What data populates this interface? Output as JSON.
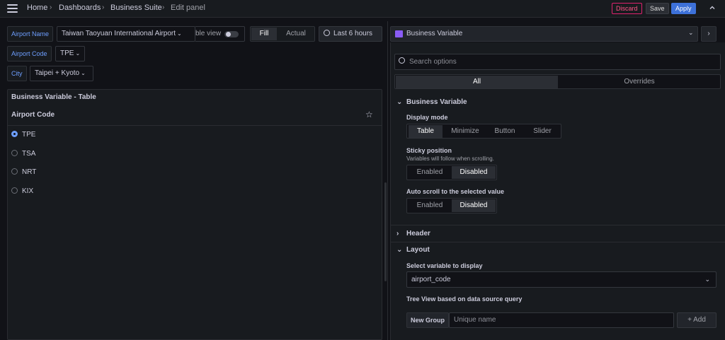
{
  "breadcrumb": {
    "home": "Home",
    "dashboards": "Dashboards",
    "suite": "Business Suite",
    "current": "Edit panel"
  },
  "toolbar": {
    "discard": "Discard",
    "save": "Save",
    "apply": "Apply"
  },
  "variables": {
    "airport_name_label": "Airport Name",
    "airport_name_value": "Taiwan Taoyuan International Airport",
    "airport_code_label": "Airport Code",
    "airport_code_value": "TPE",
    "city_label": "City",
    "city_value": "Taipei + Kyoto"
  },
  "view_toggle": {
    "label": "ble view"
  },
  "fill_actual": {
    "fill": "Fill",
    "actual": "Actual"
  },
  "time_range": "Last 6 hours",
  "panel": {
    "title": "Business Variable - Table",
    "column": "Airport Code",
    "rows": [
      {
        "label": "TPE",
        "selected": true
      },
      {
        "label": "TSA",
        "selected": false
      },
      {
        "label": "NRT",
        "selected": false
      },
      {
        "label": "KIX",
        "selected": false
      }
    ]
  },
  "options": {
    "viz_name": "Business Variable",
    "search_placeholder": "Search options",
    "tabs": [
      "All",
      "Overrides"
    ],
    "section_business": "Business Variable",
    "display_mode_label": "Display mode",
    "display_modes": [
      "Table",
      "Minimize",
      "Button",
      "Slider"
    ],
    "sticky_label": "Sticky position",
    "sticky_desc": "Variables will follow when scrolling.",
    "toggle_options": [
      "Enabled",
      "Disabled"
    ],
    "autoscroll_label": "Auto scroll to the selected value",
    "section_header": "Header",
    "section_layout": "Layout",
    "select_var_label": "Select variable to display",
    "select_var_value": "airport_code",
    "tree_view_label": "Tree View based on data source query",
    "new_group_label": "New Group",
    "unique_name_placeholder": "Unique name",
    "add_label": "+ Add"
  }
}
